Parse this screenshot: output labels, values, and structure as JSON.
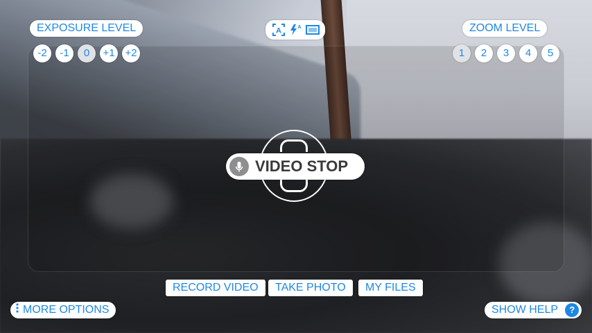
{
  "exposure": {
    "title": "EXPOSURE LEVEL",
    "levels": [
      "-2",
      "-1",
      "0",
      "+1",
      "+2"
    ],
    "selected": "0"
  },
  "zoom": {
    "title": "ZOOM LEVEL",
    "levels": [
      "1",
      "2",
      "3",
      "4",
      "5"
    ],
    "selected": "1"
  },
  "mode_icons": [
    "auto-focus-icon",
    "flash-auto-icon",
    "aspect-ratio-icon"
  ],
  "center": {
    "video_stop_label": "VIDEO STOP"
  },
  "bottom_bar": {
    "record_video": "RECORD VIDEO",
    "take_photo": "TAKE PHOTO",
    "my_files": "MY FILES"
  },
  "more_options": "MORE OPTIONS",
  "show_help": "SHOW HELP",
  "colors": {
    "accent": "#1e88e5",
    "pill_bg": "#ffffff"
  }
}
